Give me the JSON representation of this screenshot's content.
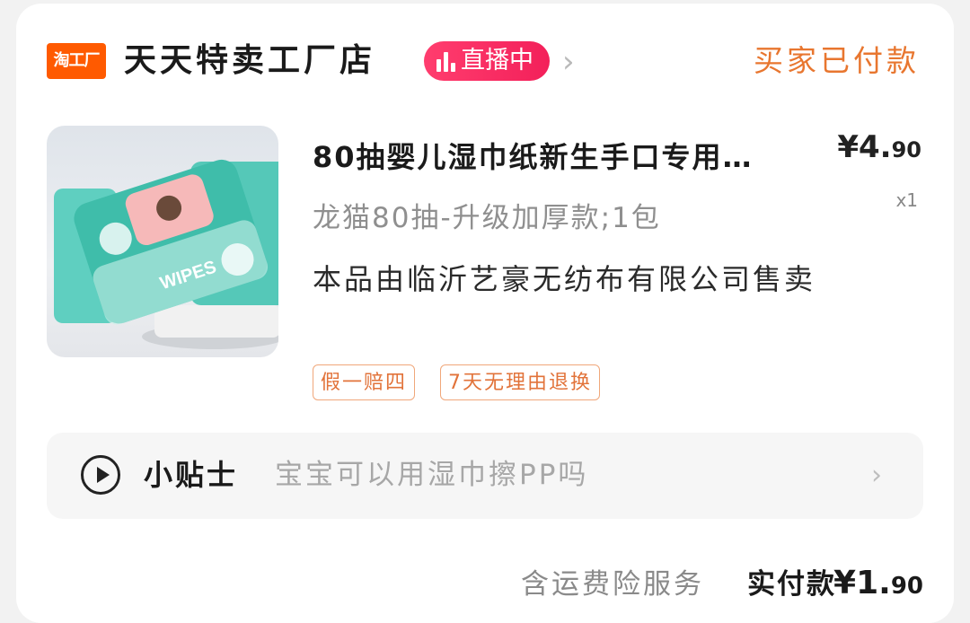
{
  "shop": {
    "logo_text": "淘工厂",
    "name": "天天特卖工厂店",
    "live_badge": "直播中",
    "order_status": "买家已付款"
  },
  "colors": {
    "accent_orange": "#e8762f",
    "logo_orange": "#ff5a00",
    "live_pink": "#f3205a",
    "tag_orange": "#e2733a"
  },
  "product": {
    "image_label": "WIPES",
    "title": "80抽婴儿湿巾纸新生手口专用…",
    "spec": "龙猫80抽-升级加厚款;1包",
    "seller_note": "本品由临沂艺豪无纺布有限公司售卖",
    "price_currency": "¥",
    "price_main": "4.",
    "price_cents": "90",
    "quantity": "x1",
    "tags": [
      "假一赔四",
      "7天无理由退换"
    ]
  },
  "tips": {
    "label": "小贴士",
    "text": "宝宝可以用湿巾擦PP吗",
    "icon": "play-circle-icon"
  },
  "summary": {
    "service_text": "含运费险服务",
    "paid_label": "实付款",
    "paid_currency": "¥",
    "paid_main": "1.",
    "paid_cents": "90"
  }
}
